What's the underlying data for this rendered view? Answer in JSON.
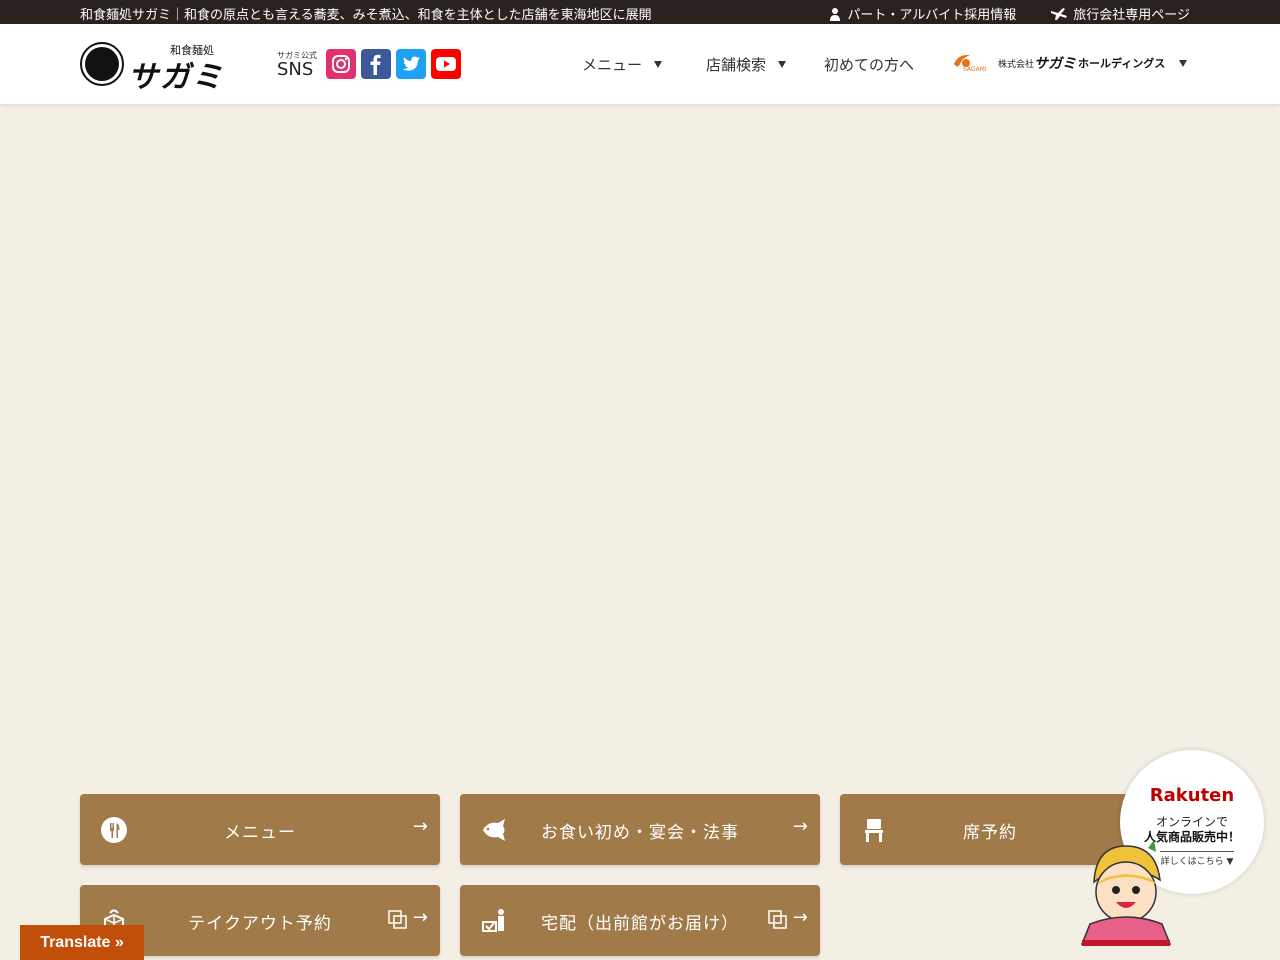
{
  "topbar": {
    "tagline": "和食麺処サガミ｜和食の原点とも言える蕎麦、みそ煮込、和食を主体とした店舗を東海地区に展開",
    "links": [
      {
        "label": "パート・アルバイト採用情報",
        "icon": "person-icon"
      },
      {
        "label": "旅行会社専用ページ",
        "icon": "airplane-icon"
      }
    ]
  },
  "logo": {
    "small_text": "和食麺処",
    "main_text": "サガミ"
  },
  "sns": {
    "sub_label": "サガミ公式",
    "label": "SNS",
    "colors": {
      "instagram": "#e1306c",
      "facebook": "#3b5998",
      "twitter": "#1da1f2",
      "youtube": "#ff0000"
    }
  },
  "nav": {
    "items": [
      {
        "label": "メニュー",
        "dropdown": true
      },
      {
        "label": "店舗検索",
        "dropdown": true
      },
      {
        "label": "初めての方へ",
        "dropdown": false
      }
    ],
    "holdings": {
      "mark_text": "SAGAMI",
      "prefix": "株式会社",
      "name": "サガミ",
      "suffix": "ホールディングス"
    }
  },
  "buttons": [
    {
      "label": "メニュー",
      "icon": "fork-knife-icon",
      "external": false
    },
    {
      "label": "お食い初め・宴会・法事",
      "icon": "sea-bream-icon",
      "external": false
    },
    {
      "label": "席予約",
      "icon": "chair-icon",
      "external": false
    },
    {
      "label": "テイクアウト予約",
      "icon": "bento-box-icon",
      "external": true
    },
    {
      "label": "宅配（出前館がお届け）",
      "icon": "delivery-icon",
      "external": true
    }
  ],
  "arrow": "→",
  "badge": {
    "brand": "Rakuten",
    "line1": "オンラインで",
    "line2": "人気商品販売中！",
    "line3": "詳しくはこちら ▼"
  },
  "translate_label": "Translate »",
  "colors": {
    "topbar": "#2a221e",
    "button": "#a07a48",
    "background": "#f3efe5",
    "translate": "#c24f09",
    "rakuten": "#bf0000"
  }
}
